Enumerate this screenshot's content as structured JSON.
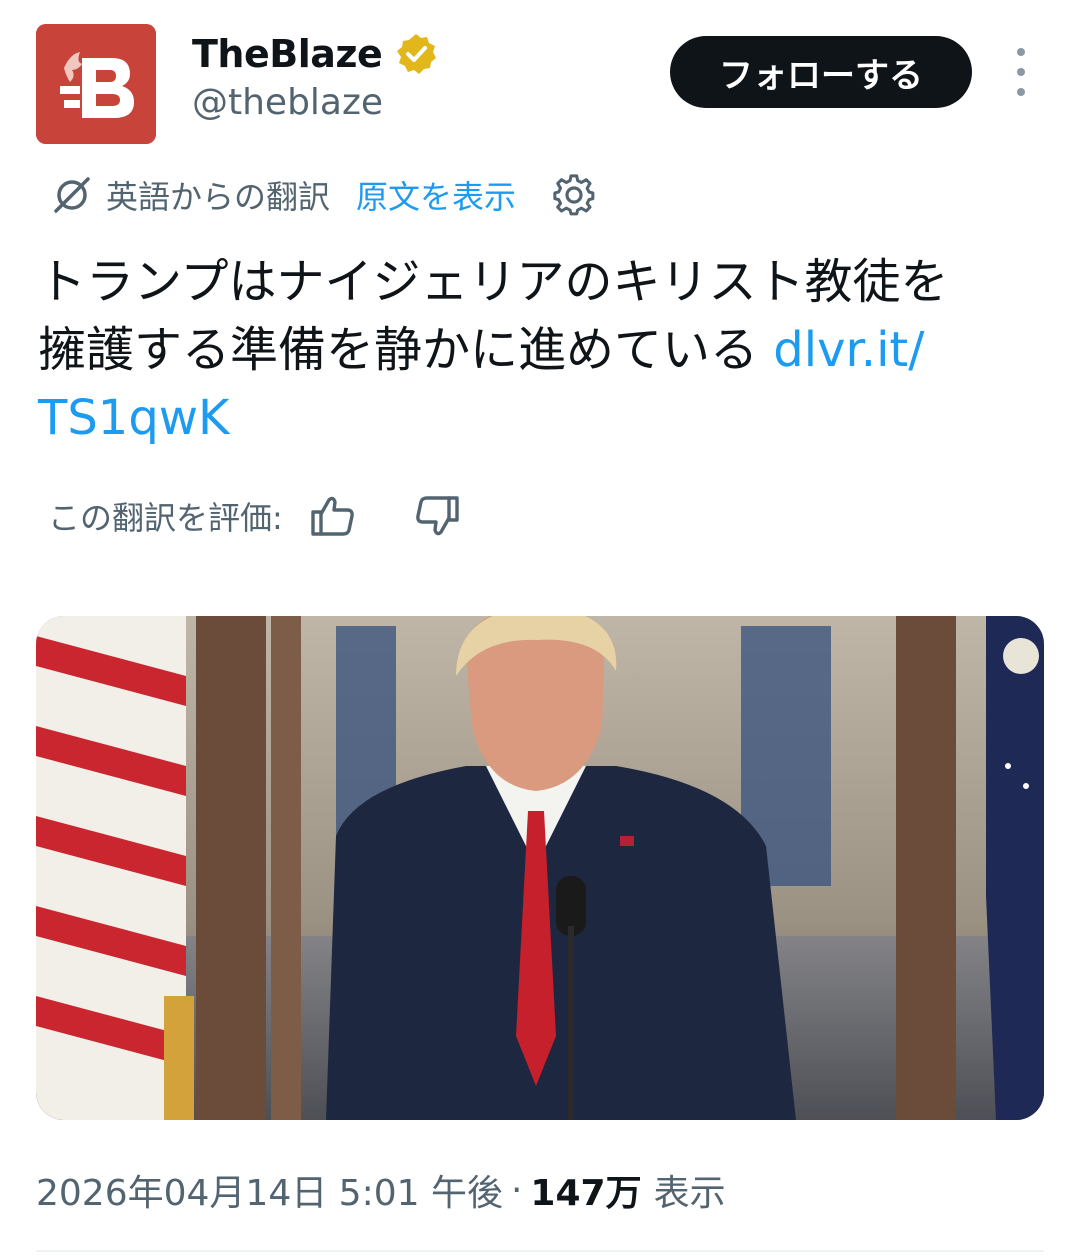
{
  "account": {
    "display_name": "TheBlaze",
    "handle": "@theblaze",
    "verified": true,
    "verified_badge_color": "#e2b719",
    "avatar_icon": "theblaze-logo",
    "avatar_color": "#c8443a"
  },
  "follow_button": {
    "label": "フォローする"
  },
  "more_icon": "more-vertical-icon",
  "translation": {
    "translated_from": "英語からの翻訳",
    "show_original": "原文を表示",
    "settings_icon": "gear-icon"
  },
  "tweet": {
    "line1": "トランプはナイジェリアのキリスト教徒を",
    "line2": "擁護する準備を静かに進めている ",
    "link_part1": "dlvr.it/",
    "link_part2": "TS1qwK"
  },
  "rate_translation": {
    "label": "この翻訳を評価:",
    "thumb_up_icon": "thumb-up-icon",
    "thumb_down_icon": "thumb-down-icon"
  },
  "meta": {
    "timestamp": "2026年04月14日 5:01 午後",
    "separator": "·",
    "views_count": "147万",
    "views_label": "表示"
  },
  "colors": {
    "link": "#1d9bf0",
    "secondary_text": "#536471",
    "primary_text": "#0f1419",
    "follow_bg": "#0f1419"
  }
}
